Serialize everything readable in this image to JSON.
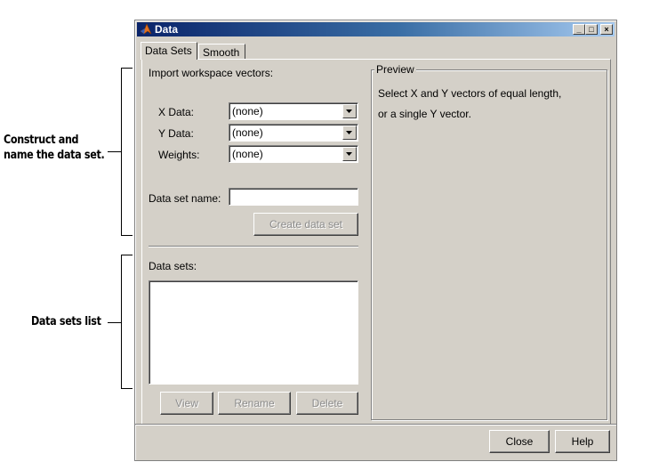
{
  "annotations": {
    "construct_line1": "Construct and",
    "construct_line2": "name the data set.",
    "list": "Data sets list"
  },
  "window": {
    "title": "Data",
    "minimize": "_",
    "maximize": "□",
    "close": "×"
  },
  "tabs": [
    {
      "label": "Data Sets",
      "active": true
    },
    {
      "label": "Smooth",
      "active": false
    }
  ],
  "import": {
    "heading": "Import workspace vectors:",
    "x_label": "X Data:",
    "x_value": "(none)",
    "y_label": "Y Data:",
    "y_value": "(none)",
    "w_label": "Weights:",
    "w_value": "(none)",
    "name_label": "Data set name:",
    "name_value": "",
    "create_button": "Create data set"
  },
  "datasets": {
    "heading": "Data sets:",
    "items": [],
    "view_button": "View",
    "rename_button": "Rename",
    "delete_button": "Delete"
  },
  "preview": {
    "title": "Preview",
    "line1": "Select X and Y vectors of equal length,",
    "line2": "or a single Y vector."
  },
  "footer": {
    "close_button": "Close",
    "help_button": "Help"
  },
  "colors": {
    "window_bg": "#d4d0c8",
    "titlebar_start": "#0a246a",
    "titlebar_end": "#a6caf0",
    "disabled_text": "#8c8c8c"
  }
}
